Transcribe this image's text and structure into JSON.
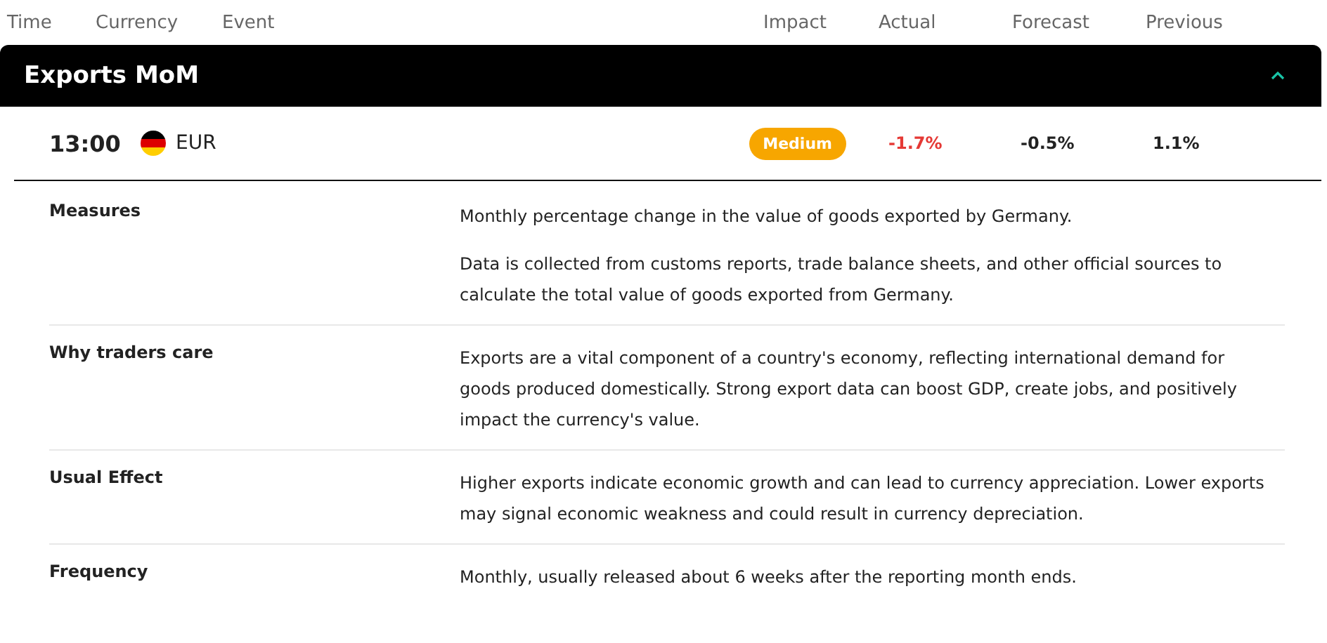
{
  "columns": [
    "Time",
    "Currency",
    "Event",
    "Impact",
    "Actual",
    "Forecast",
    "Previous"
  ],
  "event": {
    "title": "Exports MoM",
    "expanded": true,
    "time": "13:00",
    "currency": "EUR",
    "impact": "Medium",
    "actual": {
      "value": "-1.7%",
      "below_forecast": true
    },
    "forecast": "-0.5%",
    "previous": "1.1%"
  },
  "details": [
    {
      "label": "Measures",
      "paragraphs": [
        "Monthly percentage change in the value of goods exported by Germany.",
        "Data is collected from customs reports, trade balance sheets, and other official sources to calculate the total value of goods exported from Germany."
      ]
    },
    {
      "label": "Why traders care",
      "paragraphs": [
        "Exports are a vital component of a country's economy, reflecting international demand for goods produced domestically. Strong export data can boost GDP, create jobs, and positively impact the currency's value."
      ]
    },
    {
      "label": "Usual Effect",
      "paragraphs": [
        "Higher exports indicate economic growth and can lead to currency appreciation. Lower exports may signal economic weakness and could result in currency depreciation."
      ]
    },
    {
      "label": "Frequency",
      "paragraphs": [
        "Monthly, usually released about 6 weeks after the reporting month ends."
      ]
    }
  ]
}
